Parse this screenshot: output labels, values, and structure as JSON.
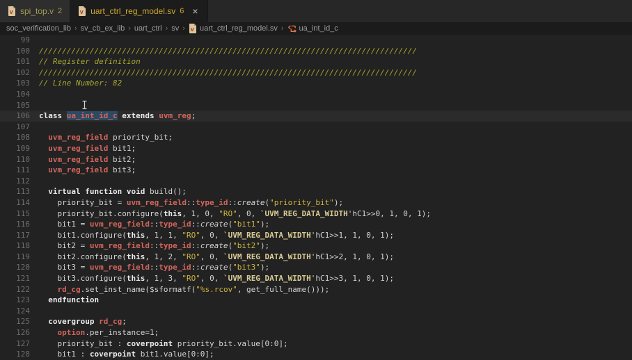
{
  "tab_bar": {
    "tabs": [
      {
        "name": "spi_top.v",
        "problem_count": "2",
        "state": "inactive"
      },
      {
        "name": "uart_ctrl_reg_model.sv",
        "problem_count": "6",
        "state": "active",
        "close_glyph": "×"
      }
    ]
  },
  "breadcrumb": {
    "separator": "›",
    "file_item": "uart_ctrl_reg_model.sv",
    "symbol_item": "ua_int_id_c",
    "path": [
      "soc_verification_lib",
      "sv_cb_ex_lib",
      "uart_ctrl",
      "sv",
      "uart_ctrl_reg_model.sv",
      "ua_int_id_c"
    ]
  },
  "editor": {
    "highlighted_word": "ua_int_id_c",
    "current_line": 106,
    "lines": [
      {
        "n": 99,
        "tokens": []
      },
      {
        "n": 100,
        "tokens": [
          [
            "c",
            "//////////////////////////////////////////////////////////////////////////////////"
          ]
        ]
      },
      {
        "n": 101,
        "tokens": [
          [
            "c",
            "// Register definition"
          ]
        ]
      },
      {
        "n": 102,
        "tokens": [
          [
            "c",
            "//////////////////////////////////////////////////////////////////////////////////"
          ]
        ]
      },
      {
        "n": 103,
        "tokens": [
          [
            "c",
            "// Line Number: 82"
          ]
        ]
      },
      {
        "n": 104,
        "tokens": []
      },
      {
        "n": 105,
        "tokens": []
      },
      {
        "n": 106,
        "current": true,
        "tokens": [
          [
            "k",
            "class"
          ],
          [
            "t",
            " "
          ],
          [
            "h",
            "ua_int_id_c"
          ],
          [
            "t",
            " "
          ],
          [
            "k",
            "extends"
          ],
          [
            "t",
            " "
          ],
          [
            "y",
            "uvm_reg"
          ],
          [
            "t",
            ";"
          ]
        ]
      },
      {
        "n": 107,
        "tokens": []
      },
      {
        "n": 108,
        "tokens": [
          [
            "t",
            "  "
          ],
          [
            "y",
            "uvm_reg_field"
          ],
          [
            "t",
            " priority_bit;"
          ]
        ]
      },
      {
        "n": 109,
        "tokens": [
          [
            "t",
            "  "
          ],
          [
            "y",
            "uvm_reg_field"
          ],
          [
            "t",
            " bit1;"
          ]
        ]
      },
      {
        "n": 110,
        "tokens": [
          [
            "t",
            "  "
          ],
          [
            "y",
            "uvm_reg_field"
          ],
          [
            "t",
            " bit2;"
          ]
        ]
      },
      {
        "n": 111,
        "tokens": [
          [
            "t",
            "  "
          ],
          [
            "y",
            "uvm_reg_field"
          ],
          [
            "t",
            " bit3;"
          ]
        ]
      },
      {
        "n": 112,
        "tokens": []
      },
      {
        "n": 113,
        "tokens": [
          [
            "t",
            "  "
          ],
          [
            "k",
            "virtual function void"
          ],
          [
            "t",
            " build();"
          ]
        ]
      },
      {
        "n": 114,
        "tokens": [
          [
            "t",
            "    priority_bit = "
          ],
          [
            "y",
            "uvm_reg_field"
          ],
          [
            "t",
            "::"
          ],
          [
            "y",
            "type_id"
          ],
          [
            "t",
            "::"
          ],
          [
            "i",
            "create"
          ],
          [
            "t",
            "("
          ],
          [
            "s",
            "\"priority_bit\""
          ],
          [
            "t",
            ");"
          ]
        ]
      },
      {
        "n": 115,
        "tokens": [
          [
            "t",
            "    priority_bit.configure("
          ],
          [
            "k",
            "this"
          ],
          [
            "t",
            ", 1, 0, "
          ],
          [
            "s",
            "\"RO\""
          ],
          [
            "t",
            ", 0, "
          ],
          [
            "m",
            "`UVM_REG_DATA_WIDTH"
          ],
          [
            "t",
            "'hC1>>0, 1, 0, 1);"
          ]
        ]
      },
      {
        "n": 116,
        "tokens": [
          [
            "t",
            "    bit1 = "
          ],
          [
            "y",
            "uvm_reg_field"
          ],
          [
            "t",
            "::"
          ],
          [
            "y",
            "type_id"
          ],
          [
            "t",
            "::"
          ],
          [
            "i",
            "create"
          ],
          [
            "t",
            "("
          ],
          [
            "s",
            "\"bit1\""
          ],
          [
            "t",
            ");"
          ]
        ]
      },
      {
        "n": 117,
        "tokens": [
          [
            "t",
            "    bit1.configure("
          ],
          [
            "k",
            "this"
          ],
          [
            "t",
            ", 1, 1, "
          ],
          [
            "s",
            "\"RO\""
          ],
          [
            "t",
            ", 0, "
          ],
          [
            "m",
            "`UVM_REG_DATA_WIDTH"
          ],
          [
            "t",
            "'hC1>>1, 1, 0, 1);"
          ]
        ]
      },
      {
        "n": 118,
        "tokens": [
          [
            "t",
            "    bit2 = "
          ],
          [
            "y",
            "uvm_reg_field"
          ],
          [
            "t",
            "::"
          ],
          [
            "y",
            "type_id"
          ],
          [
            "t",
            "::"
          ],
          [
            "i",
            "create"
          ],
          [
            "t",
            "("
          ],
          [
            "s",
            "\"bit2\""
          ],
          [
            "t",
            ");"
          ]
        ]
      },
      {
        "n": 119,
        "tokens": [
          [
            "t",
            "    bit2.configure("
          ],
          [
            "k",
            "this"
          ],
          [
            "t",
            ", 1, 2, "
          ],
          [
            "s",
            "\"RO\""
          ],
          [
            "t",
            ", 0, "
          ],
          [
            "m",
            "`UVM_REG_DATA_WIDTH"
          ],
          [
            "t",
            "'hC1>>2, 1, 0, 1);"
          ]
        ]
      },
      {
        "n": 120,
        "tokens": [
          [
            "t",
            "    bit3 = "
          ],
          [
            "y",
            "uvm_reg_field"
          ],
          [
            "t",
            "::"
          ],
          [
            "y",
            "type_id"
          ],
          [
            "t",
            "::"
          ],
          [
            "i",
            "create"
          ],
          [
            "t",
            "("
          ],
          [
            "s",
            "\"bit3\""
          ],
          [
            "t",
            ");"
          ]
        ]
      },
      {
        "n": 121,
        "tokens": [
          [
            "t",
            "    bit3.configure("
          ],
          [
            "k",
            "this"
          ],
          [
            "t",
            ", 1, 3, "
          ],
          [
            "s",
            "\"RO\""
          ],
          [
            "t",
            ", 0, "
          ],
          [
            "m",
            "`UVM_REG_DATA_WIDTH"
          ],
          [
            "t",
            "'hC1>>3, 1, 0, 1);"
          ]
        ]
      },
      {
        "n": 122,
        "tokens": [
          [
            "t",
            "    "
          ],
          [
            "y",
            "rd_cg"
          ],
          [
            "t",
            ".set_inst_name($sformatf("
          ],
          [
            "s",
            "\"%s.rcov\""
          ],
          [
            "t",
            ", get_full_name()));"
          ]
        ]
      },
      {
        "n": 123,
        "tokens": [
          [
            "t",
            "  "
          ],
          [
            "k",
            "endfunction"
          ]
        ]
      },
      {
        "n": 124,
        "tokens": []
      },
      {
        "n": 125,
        "tokens": [
          [
            "t",
            "  "
          ],
          [
            "k",
            "covergroup"
          ],
          [
            "t",
            " "
          ],
          [
            "y",
            "rd_cg"
          ],
          [
            "t",
            ";"
          ]
        ]
      },
      {
        "n": 126,
        "tokens": [
          [
            "t",
            "    "
          ],
          [
            "y",
            "option"
          ],
          [
            "t",
            ".per_instance=1;"
          ]
        ]
      },
      {
        "n": 127,
        "tokens": [
          [
            "t",
            "    priority_bit : "
          ],
          [
            "k",
            "coverpoint"
          ],
          [
            "t",
            " priority_bit.value[0:0];"
          ]
        ]
      },
      {
        "n": 128,
        "tokens": [
          [
            "t",
            "    bit1 : "
          ],
          [
            "k",
            "coverpoint"
          ],
          [
            "t",
            " bit1.value[0:0];"
          ]
        ]
      }
    ]
  },
  "colors": {
    "editor_bg": "#222222",
    "tabbar_bg": "#272727",
    "active_tab_bg": "#1c1c1c",
    "inactive_tab_bg": "#2e2e2e",
    "breadcrumb_bg": "#1b1b1b",
    "warning_yellow": "#cfa92c",
    "keyword": "#eaeaea",
    "type_red": "#d2655c",
    "string_yellow": "#cdb53e",
    "macro_cream": "#d9cb93",
    "comment_olive": "#a6a72f",
    "word_highlight_bg": "#2c4a63",
    "line_number": "#6e6e6e"
  }
}
